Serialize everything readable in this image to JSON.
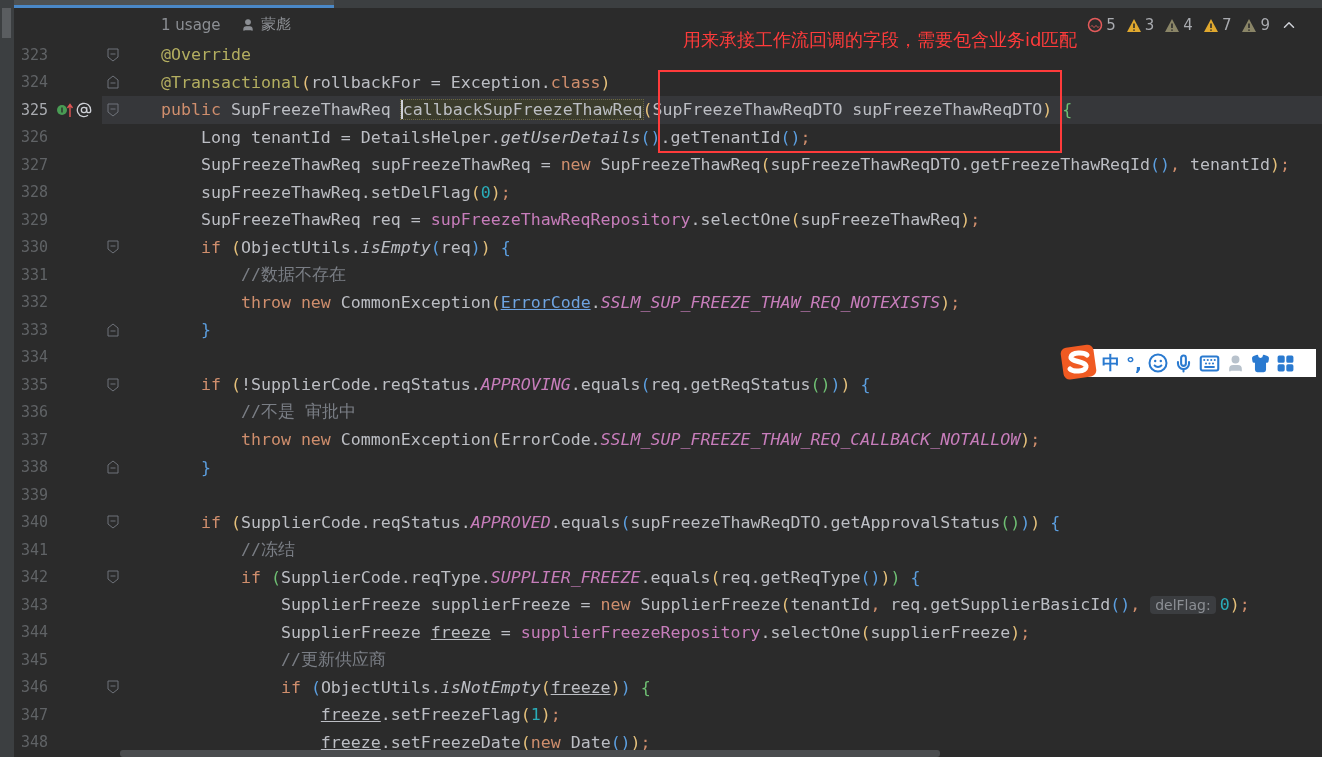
{
  "usage": {
    "count": "1 usage",
    "author": "蒙彪"
  },
  "problems": [
    {
      "kind": "error",
      "count": "5"
    },
    {
      "kind": "warning",
      "count": "3"
    },
    {
      "kind": "weak",
      "count": "4"
    },
    {
      "kind": "warning",
      "count": "7"
    },
    {
      "kind": "weak",
      "count": "9"
    }
  ],
  "annotation": {
    "text": "用来承接工作流回调的字段，需要包含业务id匹配"
  },
  "ime": {
    "mode": "中",
    "punctuation": "°,"
  },
  "lines": [
    {
      "number": "323",
      "fold_start": true,
      "fold_end": false,
      "current": false,
      "tokens": [
        {
          "kind": "ann",
          "text": "@Override"
        }
      ]
    },
    {
      "number": "324",
      "fold_start": false,
      "fold_end": true,
      "current": false,
      "tokens": [
        {
          "kind": "ann",
          "text": "@Transactional"
        },
        {
          "kind": "y",
          "text": "("
        },
        {
          "kind": "p",
          "text": "rollbackFor = Exception."
        },
        {
          "kind": "kw",
          "text": "class"
        },
        {
          "kind": "y",
          "text": ")"
        }
      ]
    },
    {
      "number": "325",
      "fold_start": true,
      "fold_end": false,
      "current": true,
      "gutter": [
        {
          "kind": "implements"
        },
        {
          "kind": "annotation"
        }
      ],
      "tokens": [
        {
          "kind": "kw",
          "text": "public "
        },
        {
          "kind": "p",
          "text": "SupFreezeThawReq "
        },
        {
          "kind": "decl",
          "text": "callbackSupFreezeThawReq"
        },
        {
          "kind": "y",
          "text": "("
        },
        {
          "kind": "p",
          "text": "SupFreezeThawReqDTO supFreezeThawReqDTO"
        },
        {
          "kind": "y",
          "text": ")"
        },
        {
          "kind": "g",
          "text": " {"
        }
      ]
    },
    {
      "number": "326",
      "fold_start": false,
      "fold_end": false,
      "current": false,
      "tokens": [
        {
          "kind": "p",
          "text": "    Long tenantId = DetailsHelper."
        },
        {
          "kind": "st",
          "text": "getUserDetails"
        },
        {
          "kind": "b",
          "text": "()"
        },
        {
          "kind": "p",
          "text": ".getTenantId"
        },
        {
          "kind": "b",
          "text": "()"
        },
        {
          "kind": "kw",
          "text": ";"
        }
      ]
    },
    {
      "number": "327",
      "fold_start": false,
      "fold_end": false,
      "current": false,
      "tokens": [
        {
          "kind": "p",
          "text": "    SupFreezeThawReq supFreezeThawReq = "
        },
        {
          "kind": "kw",
          "text": "new "
        },
        {
          "kind": "p",
          "text": "SupFreezeThawReq"
        },
        {
          "kind": "y",
          "text": "("
        },
        {
          "kind": "p",
          "text": "supFreezeThawReqDTO.getFreezeThawReqId"
        },
        {
          "kind": "b",
          "text": "()"
        },
        {
          "kind": "kw",
          "text": ", "
        },
        {
          "kind": "p",
          "text": "tenantId"
        },
        {
          "kind": "y",
          "text": ")"
        },
        {
          "kind": "kw",
          "text": ";"
        }
      ]
    },
    {
      "number": "328",
      "fold_start": false,
      "fold_end": false,
      "current": false,
      "tokens": [
        {
          "kind": "p",
          "text": "    supFreezeThawReq.setDelFlag"
        },
        {
          "kind": "y",
          "text": "("
        },
        {
          "kind": "num",
          "text": "0"
        },
        {
          "kind": "y",
          "text": ")"
        },
        {
          "kind": "kw",
          "text": ";"
        }
      ]
    },
    {
      "number": "329",
      "fold_start": false,
      "fold_end": false,
      "current": false,
      "tokens": [
        {
          "kind": "p",
          "text": "    SupFreezeThawReq req = "
        },
        {
          "kind": "fld",
          "text": "supFreezeThawReqRepository"
        },
        {
          "kind": "p",
          "text": ".selectOne"
        },
        {
          "kind": "y",
          "text": "("
        },
        {
          "kind": "p",
          "text": "supFreezeThawReq"
        },
        {
          "kind": "y",
          "text": ")"
        },
        {
          "kind": "kw",
          "text": ";"
        }
      ]
    },
    {
      "number": "330",
      "fold_start": true,
      "fold_end": false,
      "current": false,
      "tokens": [
        {
          "kind": "kw",
          "text": "    if "
        },
        {
          "kind": "y",
          "text": "("
        },
        {
          "kind": "p",
          "text": "ObjectUtils."
        },
        {
          "kind": "st",
          "text": "isEmpty"
        },
        {
          "kind": "b",
          "text": "("
        },
        {
          "kind": "p",
          "text": "req"
        },
        {
          "kind": "b",
          "text": ")"
        },
        {
          "kind": "y",
          "text": ")"
        },
        {
          "kind": "b",
          "text": " {"
        }
      ]
    },
    {
      "number": "331",
      "fold_start": false,
      "fold_end": false,
      "current": false,
      "tokens": [
        {
          "kind": "cm",
          "text": "        //数据不存在"
        }
      ]
    },
    {
      "number": "332",
      "fold_start": false,
      "fold_end": false,
      "current": false,
      "tokens": [
        {
          "kind": "kw",
          "text": "        throw new "
        },
        {
          "kind": "p",
          "text": "CommonException"
        },
        {
          "kind": "y",
          "text": "("
        },
        {
          "kind": "link",
          "text": "ErrorCode"
        },
        {
          "kind": "p",
          "text": "."
        },
        {
          "kind": "cst",
          "text": "SSLM_SUP_FREEZE_THAW_REQ_NOTEXISTS"
        },
        {
          "kind": "y",
          "text": ")"
        },
        {
          "kind": "kw",
          "text": ";"
        }
      ]
    },
    {
      "number": "333",
      "fold_start": false,
      "fold_end": true,
      "current": false,
      "tokens": [
        {
          "kind": "b",
          "text": "    }"
        }
      ]
    },
    {
      "number": "334",
      "fold_start": false,
      "fold_end": false,
      "current": false
    },
    {
      "number": "335",
      "fold_start": true,
      "fold_end": false,
      "current": false,
      "tokens": [
        {
          "kind": "kw",
          "text": "    if "
        },
        {
          "kind": "y",
          "text": "("
        },
        {
          "kind": "p",
          "text": "!SupplierCode.reqStatus."
        },
        {
          "kind": "cst",
          "text": "APPROVING"
        },
        {
          "kind": "p",
          "text": ".equals"
        },
        {
          "kind": "b",
          "text": "("
        },
        {
          "kind": "p",
          "text": "req.getReqStatus"
        },
        {
          "kind": "g",
          "text": "()"
        },
        {
          "kind": "b",
          "text": ")"
        },
        {
          "kind": "y",
          "text": ")"
        },
        {
          "kind": "b",
          "text": " {"
        }
      ]
    },
    {
      "number": "336",
      "fold_start": false,
      "fold_end": false,
      "current": false,
      "tokens": [
        {
          "kind": "cm",
          "text": "        //不是 审批中"
        }
      ]
    },
    {
      "number": "337",
      "fold_start": false,
      "fold_end": false,
      "current": false,
      "tokens": [
        {
          "kind": "kw",
          "text": "        throw new "
        },
        {
          "kind": "p",
          "text": "CommonException"
        },
        {
          "kind": "y",
          "text": "("
        },
        {
          "kind": "p",
          "text": "ErrorCode."
        },
        {
          "kind": "cst",
          "text": "SSLM_SUP_FREEZE_THAW_REQ_CALLBACK_NOTALLOW"
        },
        {
          "kind": "y",
          "text": ")"
        },
        {
          "kind": "kw",
          "text": ";"
        }
      ]
    },
    {
      "number": "338",
      "fold_start": false,
      "fold_end": true,
      "current": false,
      "tokens": [
        {
          "kind": "b",
          "text": "    }"
        }
      ]
    },
    {
      "number": "339",
      "fold_start": false,
      "fold_end": false,
      "current": false
    },
    {
      "number": "340",
      "fold_start": true,
      "fold_end": false,
      "current": false,
      "tokens": [
        {
          "kind": "kw",
          "text": "    if "
        },
        {
          "kind": "y",
          "text": "("
        },
        {
          "kind": "p",
          "text": "SupplierCode.reqStatus."
        },
        {
          "kind": "cst",
          "text": "APPROVED"
        },
        {
          "kind": "p",
          "text": ".equals"
        },
        {
          "kind": "b",
          "text": "("
        },
        {
          "kind": "p",
          "text": "supFreezeThawReqDTO.getApprovalStatus"
        },
        {
          "kind": "g",
          "text": "()"
        },
        {
          "kind": "b",
          "text": ")"
        },
        {
          "kind": "y",
          "text": ")"
        },
        {
          "kind": "b",
          "text": " {"
        }
      ]
    },
    {
      "number": "341",
      "fold_start": false,
      "fold_end": false,
      "current": false,
      "tokens": [
        {
          "kind": "cm",
          "text": "        //冻结"
        }
      ]
    },
    {
      "number": "342",
      "fold_start": true,
      "fold_end": false,
      "current": false,
      "tokens": [
        {
          "kind": "kw",
          "text": "        if "
        },
        {
          "kind": "g",
          "text": "("
        },
        {
          "kind": "p",
          "text": "SupplierCode.reqType."
        },
        {
          "kind": "cst",
          "text": "SUPPLIER_FREEZE"
        },
        {
          "kind": "p",
          "text": ".equals"
        },
        {
          "kind": "y",
          "text": "("
        },
        {
          "kind": "p",
          "text": "req.getReqType"
        },
        {
          "kind": "b",
          "text": "()"
        },
        {
          "kind": "y",
          "text": ")"
        },
        {
          "kind": "g",
          "text": ")"
        },
        {
          "kind": "b",
          "text": " {"
        }
      ]
    },
    {
      "number": "343",
      "fold_start": false,
      "fold_end": false,
      "current": false,
      "tokens": [
        {
          "kind": "p",
          "text": "            SupplierFreeze supplierFreeze = "
        },
        {
          "kind": "kw",
          "text": "new "
        },
        {
          "kind": "p",
          "text": "SupplierFreeze"
        },
        {
          "kind": "y",
          "text": "("
        },
        {
          "kind": "p",
          "text": "tenantId"
        },
        {
          "kind": "kw",
          "text": ", "
        },
        {
          "kind": "p",
          "text": "req.getSupplierBasicId"
        },
        {
          "kind": "b",
          "text": "()"
        },
        {
          "kind": "kw",
          "text": ", "
        },
        {
          "kind": "hint",
          "text": "delFlag:"
        },
        {
          "kind": "num",
          "text": "0"
        },
        {
          "kind": "y",
          "text": ")"
        },
        {
          "kind": "kw",
          "text": ";"
        }
      ]
    },
    {
      "number": "344",
      "fold_start": false,
      "fold_end": false,
      "current": false,
      "tokens": [
        {
          "kind": "p",
          "text": "            SupplierFreeze "
        },
        {
          "kind": "ul",
          "text": "freeze"
        },
        {
          "kind": "p",
          "text": " = "
        },
        {
          "kind": "fld",
          "text": "supplierFreezeRepository"
        },
        {
          "kind": "p",
          "text": ".selectOne"
        },
        {
          "kind": "y",
          "text": "("
        },
        {
          "kind": "p",
          "text": "supplierFreeze"
        },
        {
          "kind": "y",
          "text": ")"
        },
        {
          "kind": "kw",
          "text": ";"
        }
      ]
    },
    {
      "number": "345",
      "fold_start": false,
      "fold_end": false,
      "current": false,
      "tokens": [
        {
          "kind": "cm",
          "text": "            //更新供应商"
        }
      ]
    },
    {
      "number": "346",
      "fold_start": true,
      "fold_end": false,
      "current": false,
      "tokens": [
        {
          "kind": "kw",
          "text": "            if "
        },
        {
          "kind": "b",
          "text": "("
        },
        {
          "kind": "p",
          "text": "ObjectUtils."
        },
        {
          "kind": "st",
          "text": "isNotEmpty"
        },
        {
          "kind": "y",
          "text": "("
        },
        {
          "kind": "ul",
          "text": "freeze"
        },
        {
          "kind": "y",
          "text": ")"
        },
        {
          "kind": "b",
          "text": ")"
        },
        {
          "kind": "g",
          "text": " {"
        }
      ]
    },
    {
      "number": "347",
      "fold_start": false,
      "fold_end": false,
      "current": false,
      "tokens": [
        {
          "kind": "ul",
          "text": "                freeze"
        },
        {
          "kind": "p",
          "text": ".setFreezeFlag"
        },
        {
          "kind": "y",
          "text": "("
        },
        {
          "kind": "num",
          "text": "1"
        },
        {
          "kind": "y",
          "text": ")"
        },
        {
          "kind": "kw",
          "text": ";"
        }
      ]
    },
    {
      "number": "348",
      "fold_start": false,
      "fold_end": false,
      "current": false,
      "tokens": [
        {
          "kind": "ul",
          "text": "                freeze"
        },
        {
          "kind": "p",
          "text": ".setFreezeDate"
        },
        {
          "kind": "y",
          "text": "("
        },
        {
          "kind": "kw",
          "text": "new "
        },
        {
          "kind": "p",
          "text": "Date"
        },
        {
          "kind": "b",
          "text": "()"
        },
        {
          "kind": "y",
          "text": ")"
        },
        {
          "kind": "kw",
          "text": ";"
        }
      ]
    }
  ]
}
